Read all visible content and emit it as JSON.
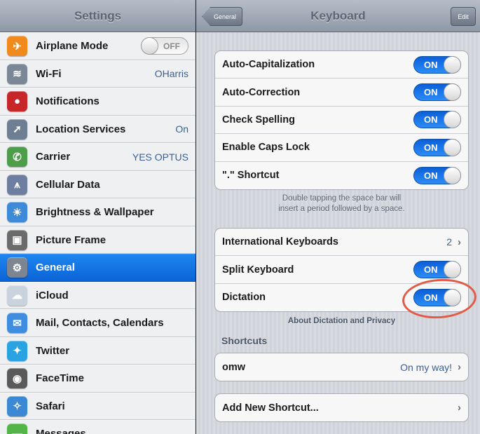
{
  "sidebar": {
    "title": "Settings",
    "items": [
      {
        "label": "Airplane Mode",
        "toggle": "OFF",
        "icon": "airplane-icon",
        "color": "#f08a1c",
        "glyph": "✈"
      },
      {
        "label": "Wi-Fi",
        "value": "OHarris",
        "icon": "wifi-icon",
        "color": "#7a8796",
        "glyph": "≋"
      },
      {
        "label": "Notifications",
        "icon": "notifications-icon",
        "color": "#c8272a",
        "glyph": "●"
      },
      {
        "label": "Location Services",
        "value": "On",
        "icon": "location-icon",
        "color": "#6f7f93",
        "glyph": "➚"
      },
      {
        "label": "Carrier",
        "value": "YES OPTUS",
        "icon": "phone-icon",
        "color": "#4d9d4a",
        "glyph": "✆"
      },
      {
        "label": "Cellular Data",
        "icon": "cellular-icon",
        "color": "#6e7ea0",
        "glyph": "⩚"
      },
      {
        "label": "Brightness & Wallpaper",
        "icon": "brightness-icon",
        "color": "#3c8ad8",
        "glyph": "☀"
      },
      {
        "label": "Picture Frame",
        "icon": "picture-frame-icon",
        "color": "#6b6b6b",
        "glyph": "▣"
      },
      {
        "label": "General",
        "icon": "gear-icon",
        "color": "#7d8590",
        "glyph": "⚙",
        "selected": true
      },
      {
        "label": "iCloud",
        "icon": "cloud-icon",
        "color": "#c9d3de",
        "glyph": "☁"
      },
      {
        "label": "Mail, Contacts, Calendars",
        "icon": "mail-icon",
        "color": "#3f8de0",
        "glyph": "✉"
      },
      {
        "label": "Twitter",
        "icon": "twitter-bird-icon",
        "color": "#2aa3e2",
        "glyph": "✦"
      },
      {
        "label": "FaceTime",
        "icon": "facetime-icon",
        "color": "#5a5a5a",
        "glyph": "◉"
      },
      {
        "label": "Safari",
        "icon": "safari-compass-icon",
        "color": "#3b88d4",
        "glyph": "✧"
      },
      {
        "label": "Messages",
        "icon": "messages-icon",
        "color": "#53b548",
        "glyph": "▬"
      }
    ]
  },
  "detail": {
    "title": "Keyboard",
    "back_label": "General",
    "edit_label": "Edit",
    "group1": [
      {
        "label": "Auto-Capitalization",
        "toggle": "ON"
      },
      {
        "label": "Auto-Correction",
        "toggle": "ON"
      },
      {
        "label": "Check Spelling",
        "toggle": "ON"
      },
      {
        "label": "Enable Caps Lock",
        "toggle": "ON"
      },
      {
        "label": "\".\" Shortcut",
        "toggle": "ON"
      }
    ],
    "group1_footer_line1": "Double tapping the space bar will",
    "group1_footer_line2": "insert a period followed by a space.",
    "group2": [
      {
        "label": "International Keyboards",
        "value": "2"
      },
      {
        "label": "Split Keyboard",
        "toggle": "ON"
      },
      {
        "label": "Dictation",
        "toggle": "ON"
      }
    ],
    "dictation_link": "About Dictation and Privacy",
    "shortcuts_header": "Shortcuts",
    "shortcut_row": {
      "label": "omw",
      "value": "On my way!"
    },
    "add_shortcut": "Add New Shortcut...",
    "chevron": "›"
  },
  "colors": {
    "selected": "#1476e6",
    "toggle_on": "#1b78ec",
    "highlight": "#e25a48"
  }
}
